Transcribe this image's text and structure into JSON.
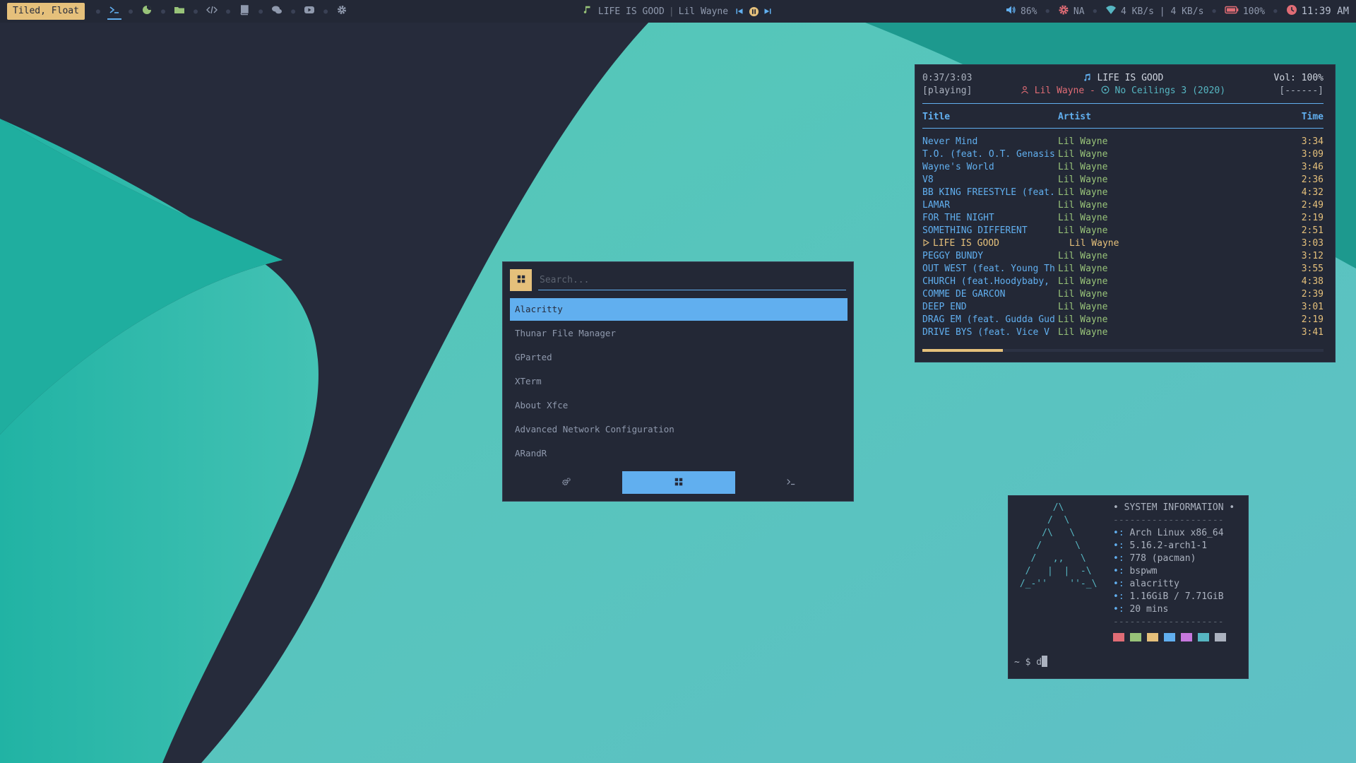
{
  "colors": {
    "bar_bg": "#232836",
    "accent_blue": "#61afef",
    "accent_yellow": "#e5c07b",
    "accent_green": "#98c379",
    "accent_red": "#e06c75",
    "accent_cyan": "#56b6c2",
    "wallpaper_dark": "#262b3b",
    "wallpaper_teal": "#49c3b0"
  },
  "topbar": {
    "layout_label": "Tiled, Float",
    "workspaces": [
      {
        "name": "terminal",
        "icon": "terminal-icon",
        "active": true
      },
      {
        "name": "browser",
        "icon": "firefox-icon",
        "active": false
      },
      {
        "name": "files",
        "icon": "folder-icon",
        "active": false
      },
      {
        "name": "code",
        "icon": "code-icon",
        "active": false
      },
      {
        "name": "docs",
        "icon": "book-icon",
        "active": false
      },
      {
        "name": "chat",
        "icon": "chat-icon",
        "active": false
      },
      {
        "name": "media",
        "icon": "youtube-icon",
        "active": false
      },
      {
        "name": "settings",
        "icon": "gear-icon",
        "active": false
      }
    ],
    "now_playing": {
      "song": "LIFE IS GOOD",
      "artist": "Lil Wayne",
      "separator": "|"
    },
    "volume": "86%",
    "cpu": "NA",
    "network": "4 KB/s | 4 KB/s",
    "battery": "100%",
    "clock": "11:39 AM"
  },
  "music_player": {
    "elapsed": "0:37/3:03",
    "state": "[playing]",
    "title": "LIFE IS GOOD",
    "artist": "Lil Wayne -",
    "album": "No Ceilings 3 (2020)",
    "volume": "Vol: 100%",
    "flags": "[------]",
    "progress": 0.2,
    "columns": {
      "title": "Title",
      "artist": "Artist",
      "time": "Time"
    },
    "tracks": [
      {
        "title": "Never Mind",
        "artist": "Lil Wayne",
        "time": "3:34"
      },
      {
        "title": "T.O. (feat. O.T. Genasis",
        "artist": "Lil Wayne",
        "time": "3:09"
      },
      {
        "title": "Wayne's World",
        "artist": "Lil Wayne",
        "time": "3:46"
      },
      {
        "title": "V8",
        "artist": "Lil Wayne",
        "time": "2:36"
      },
      {
        "title": "BB KING FREESTYLE (feat.",
        "artist": "Lil Wayne",
        "time": "4:32"
      },
      {
        "title": "LAMAR",
        "artist": "Lil Wayne",
        "time": "2:49"
      },
      {
        "title": "FOR THE NIGHT",
        "artist": "Lil Wayne",
        "time": "2:19"
      },
      {
        "title": "SOMETHING DIFFERENT",
        "artist": "Lil Wayne",
        "time": "2:51"
      },
      {
        "title": "LIFE IS GOOD",
        "artist": "Lil Wayne",
        "time": "3:03",
        "current": true
      },
      {
        "title": "PEGGY BUNDY",
        "artist": "Lil Wayne",
        "time": "3:12"
      },
      {
        "title": "OUT WEST (feat. Young Th",
        "artist": "Lil Wayne",
        "time": "3:55"
      },
      {
        "title": "CHURCH (feat.Hoodybaby,",
        "artist": "Lil Wayne",
        "time": "4:38"
      },
      {
        "title": "COMME DE GARCON",
        "artist": "Lil Wayne",
        "time": "2:39"
      },
      {
        "title": "DEEP END",
        "artist": "Lil Wayne",
        "time": "3:01"
      },
      {
        "title": "DRAG EM (feat. Gudda Gud",
        "artist": "Lil Wayne",
        "time": "2:19"
      },
      {
        "title": "DRIVE BYS (feat. Vice V",
        "artist": "Lil Wayne",
        "time": "3:41"
      }
    ]
  },
  "launcher": {
    "search_placeholder": "Search...",
    "items": [
      {
        "label": "Alacritty",
        "selected": true
      },
      {
        "label": "Thunar File Manager"
      },
      {
        "label": "GParted"
      },
      {
        "label": "XTerm"
      },
      {
        "label": "About Xfce"
      },
      {
        "label": "Advanced Network Configuration"
      },
      {
        "label": "ARandR"
      }
    ],
    "modes": [
      {
        "name": "settings",
        "icon": "cogs-icon",
        "active": false
      },
      {
        "name": "apps",
        "icon": "grid-icon",
        "active": true
      },
      {
        "name": "run",
        "icon": "terminal-icon",
        "active": false
      }
    ]
  },
  "terminal": {
    "ascii_art": "       /\\\n      /  \\\n     /\\   \\\n    /      \\\n   /   ,,   \\\n  /   |  |  -\\\n /_-''    ''-_\\",
    "header": "• SYSTEM INFORMATION •",
    "rule": "--------------------",
    "key_glyph": "•:",
    "info": [
      "Arch Linux x86_64",
      "5.16.2-arch1-1",
      "778 (pacman)",
      "bspwm",
      "alacritty",
      "1.16GiB / 7.71GiB",
      "20 mins"
    ],
    "swatch_colors": [
      "#e06c75",
      "#98c379",
      "#e5c07b",
      "#61afef",
      "#c678dd",
      "#56b6c2",
      "#abb2bf"
    ],
    "prompt": "~ $ d"
  }
}
